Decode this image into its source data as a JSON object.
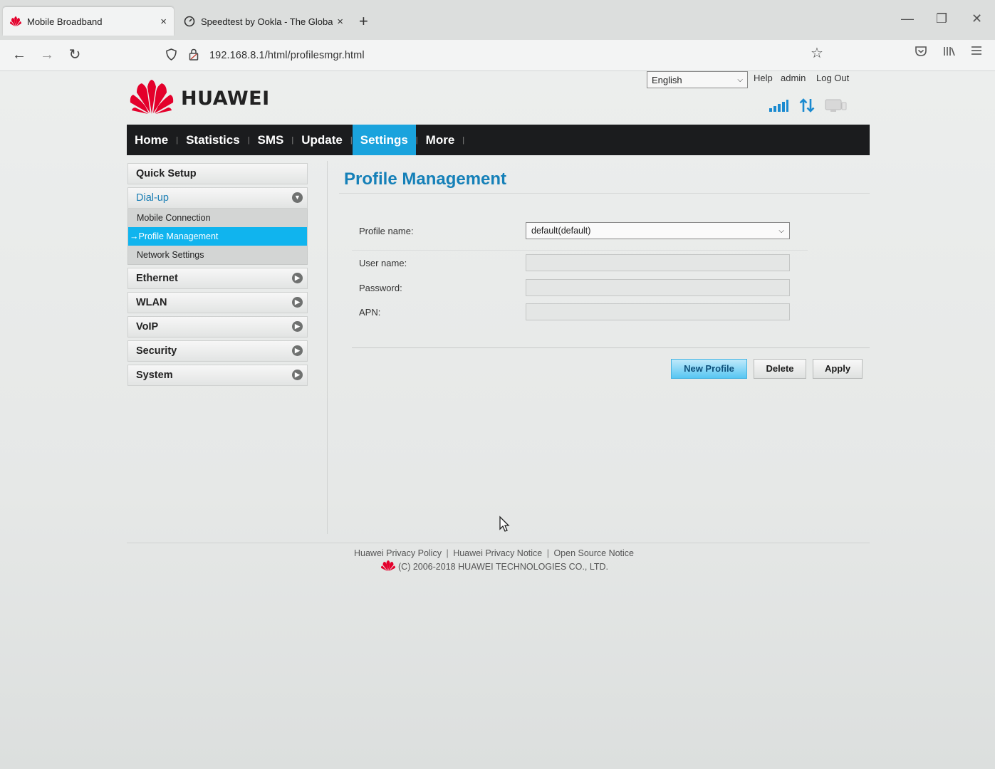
{
  "browser": {
    "tabs": [
      {
        "title": "Mobile Broadband",
        "active": true,
        "icon": "huawei-logo-icon"
      },
      {
        "title": "Speedtest by Ookla - The Global",
        "active": false,
        "icon": "speedometer-icon"
      }
    ],
    "new_tab_label": "+",
    "close_glyph": "×",
    "url": "192.168.8.1/html/profilesmgr.html"
  },
  "header": {
    "brand": "HUAWEI",
    "language": "English",
    "links": {
      "help": "Help",
      "user": "admin",
      "logout": "Log Out"
    },
    "brand_color": "#e4002b"
  },
  "menu": {
    "items": [
      "Home",
      "Statistics",
      "SMS",
      "Update",
      "Settings",
      "More"
    ],
    "active": "Settings",
    "accent": "#1aa3dd"
  },
  "sidebar": {
    "quick_setup": "Quick Setup",
    "dialup": {
      "label": "Dial-up",
      "children": [
        "Mobile Connection",
        "Profile Management",
        "Network Settings"
      ],
      "selected": "Profile Management",
      "selected_marker": "→"
    },
    "items": [
      "Ethernet",
      "WLAN",
      "VoIP",
      "Security",
      "System"
    ]
  },
  "main": {
    "title": "Profile Management",
    "form": {
      "profile_name_label": "Profile name:",
      "profile_name_value": "default(default)",
      "username_label": "User name:",
      "password_label": "Password:",
      "apn_label": "APN:"
    },
    "buttons": {
      "new_profile": "New Profile",
      "delete": "Delete",
      "apply": "Apply"
    }
  },
  "footer": {
    "links": [
      "Huawei Privacy Policy",
      "Huawei Privacy Notice",
      "Open Source Notice"
    ],
    "separator": "|",
    "copyright": "(C) 2006-2018 HUAWEI TECHNOLOGIES CO., LTD."
  }
}
